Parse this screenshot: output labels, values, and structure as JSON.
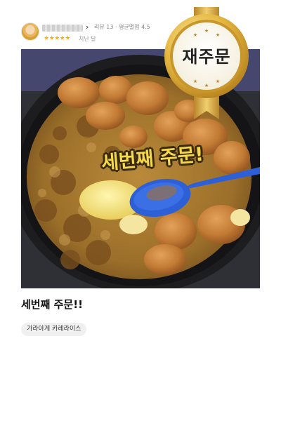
{
  "review": {
    "meta": "리뷰 13 · 평균별점 4.5",
    "stars": "★★★★★",
    "time": "지난 달",
    "rating": 5
  },
  "badge": {
    "text": "재주문"
  },
  "photo": {
    "overlay_text": "세번째 주문!"
  },
  "title": "세번째 주문!!",
  "tags": [
    "가라아게 카레라이스"
  ],
  "colors": {
    "star": "#f5b400",
    "badge_gold": "#d9a62a",
    "overlay_text": "#f6d94a",
    "spoon": "#2d5fd6"
  },
  "icons": {
    "avatar": "user-avatar-icon",
    "chevron": "chevron-right-icon"
  }
}
